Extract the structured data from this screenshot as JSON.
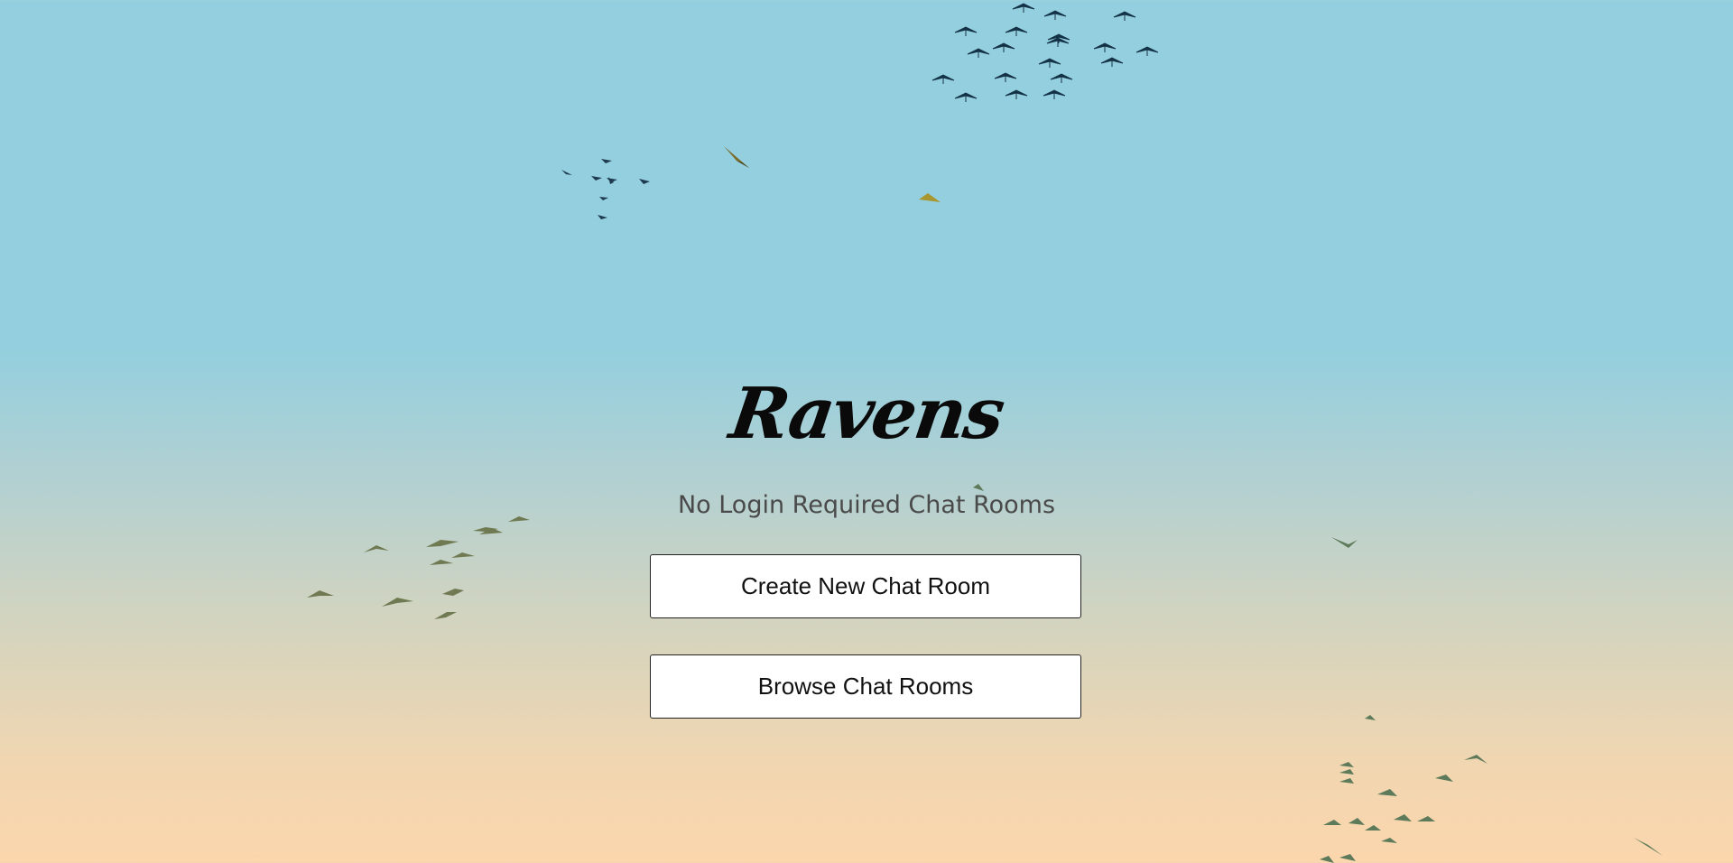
{
  "app": {
    "title": "Ravens",
    "subtitle": "No Login Required Chat Rooms"
  },
  "actions": {
    "create_label": "Create New Chat Room",
    "browse_label": "Browse Chat Rooms"
  },
  "colors": {
    "sky_top": "#93cfdf",
    "sky_bottom": "#fcd6ad",
    "flock_dark": "#143246",
    "flock_olive": "#6f7a52",
    "flock_green": "#6f8a66",
    "bird_gold": "#8a7a2e"
  }
}
